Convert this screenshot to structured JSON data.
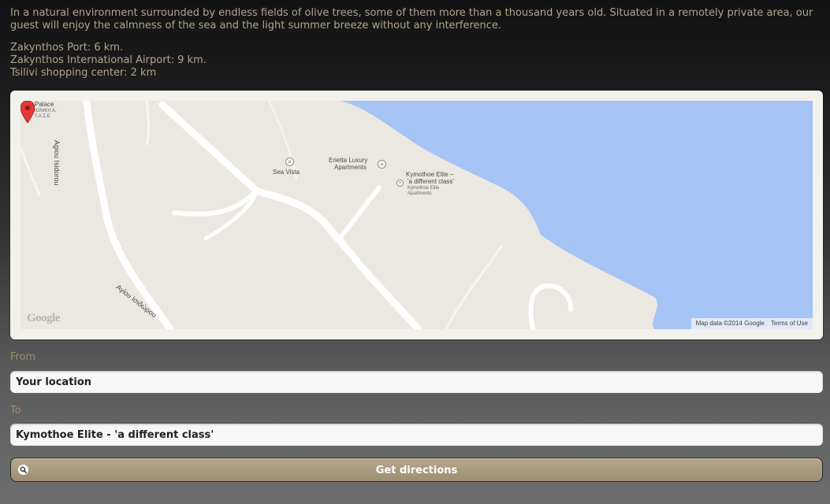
{
  "description": {
    "intro": "In a natural environment surrounded by endless fields of olive trees, some of them more than a thousand years old. Situated in a remotely private area, our guest will enjoy the calmness of the sea and the light summer breeze without any interference.",
    "distances": [
      "Zakynthos Port: 6 km.",
      "Zakynthos International Airport: 9 km.",
      "Tsilivi shopping center: 2 km"
    ]
  },
  "map": {
    "colors": {
      "land": "#ebe8e2",
      "sea": "#a5c3f5",
      "road": "#ffffff"
    },
    "labels": {
      "palace": "Palace",
      "palace_sub1": "ΙΟΝΙΚΗ Α.",
      "palace_sub2": "Τ.Α.Σ.Ε",
      "road_1": "Agiou Isidorou",
      "road_2": "Αγίου Ισιδώρου",
      "sea_vista": "Sea Vista",
      "erietta_1": "Erietta Luxury",
      "erietta_2": "Apartments",
      "kymothoe_1": "Kymothoe Elite –",
      "kymothoe_2": "'a different class'",
      "kymothoe_sub1": "Kymothoe Elite",
      "kymothoe_sub2": "Apartments"
    },
    "icons": {
      "hotel": "hotel-icon",
      "pin": "map-pin-icon"
    },
    "logo_text": "Google",
    "attribution": "Map data ©2014 Google",
    "terms": "Terms of Use"
  },
  "form": {
    "from_label": "From",
    "from_value": "Your location",
    "to_label": "To",
    "to_value": "Kymothoe Elite - 'a different class'",
    "button_label": "Get directions",
    "button_icon": "search-icon"
  }
}
